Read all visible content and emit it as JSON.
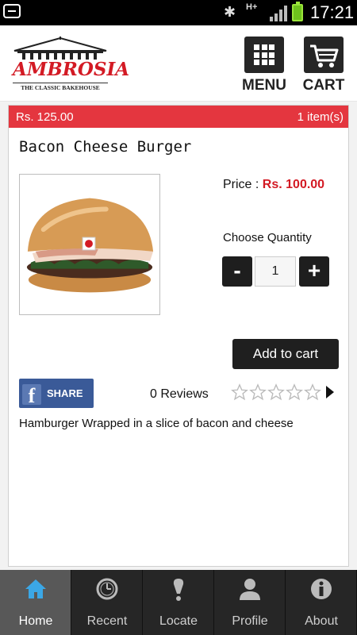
{
  "status_bar": {
    "network": "H+",
    "time": "17:21"
  },
  "header": {
    "logo": {
      "brand": "AMBROSIA",
      "tagline": "THE CLASSIC BAKEHOUSE"
    },
    "menu_label": "MENU",
    "cart_label": "CART"
  },
  "cart_summary": {
    "total": "Rs. 125.00",
    "items": "1 item(s)"
  },
  "product": {
    "name": "Bacon Cheese Burger",
    "price_label": "Price :",
    "price_value": "Rs. 100.00",
    "quantity_label": "Choose Quantity",
    "quantity": "1",
    "minus": "-",
    "plus": "+",
    "add_to_cart": "Add to cart",
    "share_label": "SHARE",
    "reviews": "0 Reviews",
    "rating": 0,
    "rating_max": 5,
    "description": "Hamburger Wrapped in a slice of bacon and cheese"
  },
  "tabs": [
    {
      "label": "Home",
      "icon": "home-icon",
      "active": true
    },
    {
      "label": "Recent",
      "icon": "clock-icon",
      "active": false
    },
    {
      "label": "Locate",
      "icon": "location-pin-icon",
      "active": false
    },
    {
      "label": "Profile",
      "icon": "user-icon",
      "active": false
    },
    {
      "label": "About",
      "icon": "info-icon",
      "active": false
    }
  ],
  "colors": {
    "accent_red": "#e4363f",
    "price_red": "#d31a24",
    "dark_button": "#1f1f1f",
    "facebook_blue": "#3a5a98",
    "tabbar": "#262626",
    "tab_active": "#585858"
  }
}
